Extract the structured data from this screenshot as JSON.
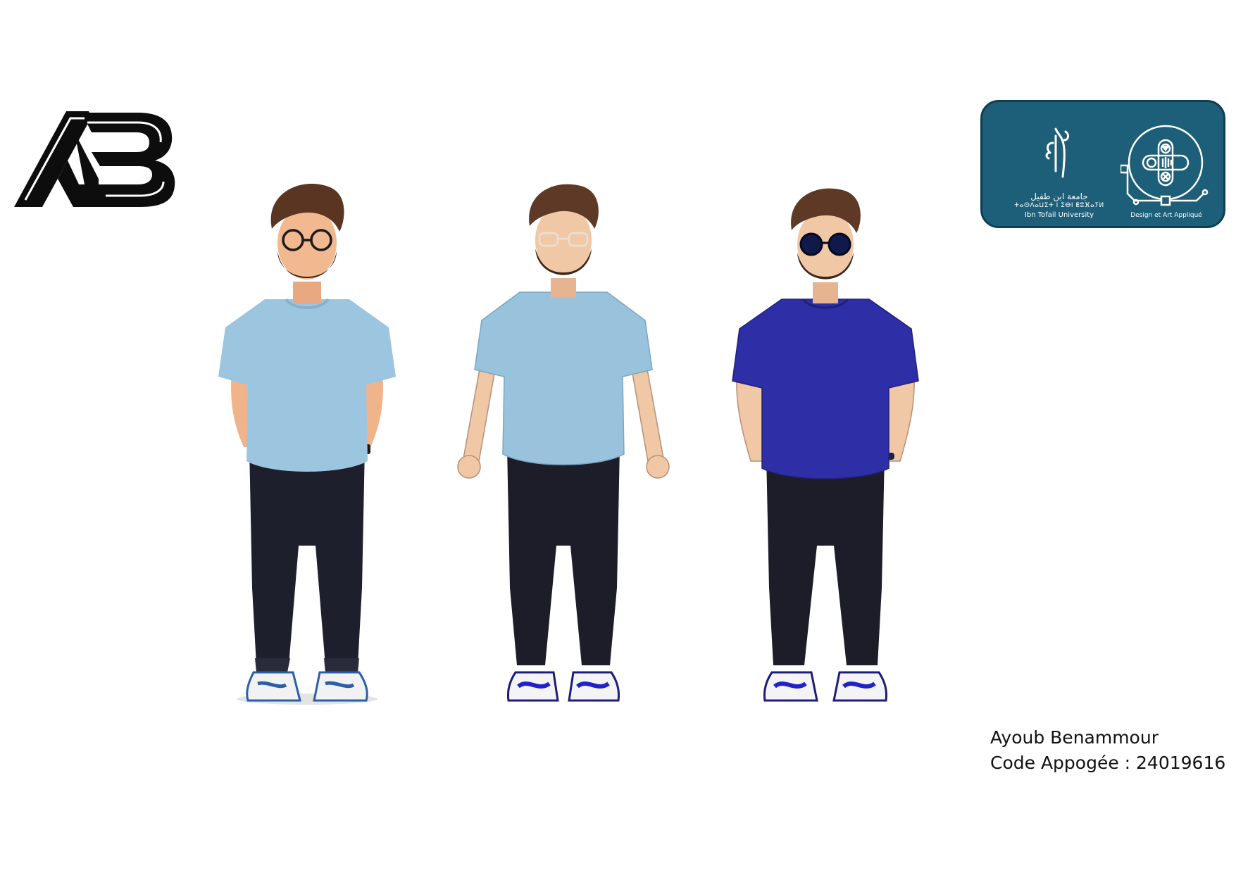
{
  "logo": {
    "letters": "AB"
  },
  "university_badge": {
    "arabic_name": "جامعة ابن طفيل",
    "tifinagh_name": "ⵜⴰⵙⴷⴰⵡⵉⵜ ⵏ ⵉⴱⵏ ⵟⵓⴼⴰⵢⵍ",
    "english_name": "Ibn Tofail University",
    "department_name": "Design et Art Appliqué",
    "badge_color": "#1d5f79"
  },
  "figures": [
    {
      "label": "character-realistic",
      "shirt_color": "#9cc6df",
      "pants_color": "#1e1f2c",
      "eyewear": "glasses"
    },
    {
      "label": "character-vector-clear-glasses",
      "shirt_color": "#99c3dc",
      "pants_color": "#1c1d29",
      "eyewear": "clear-glasses"
    },
    {
      "label": "character-vector-sunglasses",
      "shirt_color": "#2e2ea6",
      "pants_color": "#1c1d29",
      "eyewear": "sunglasses"
    }
  ],
  "caption": {
    "name": "Ayoub Benammour",
    "code_line": "Code Appogée : 24019616"
  }
}
